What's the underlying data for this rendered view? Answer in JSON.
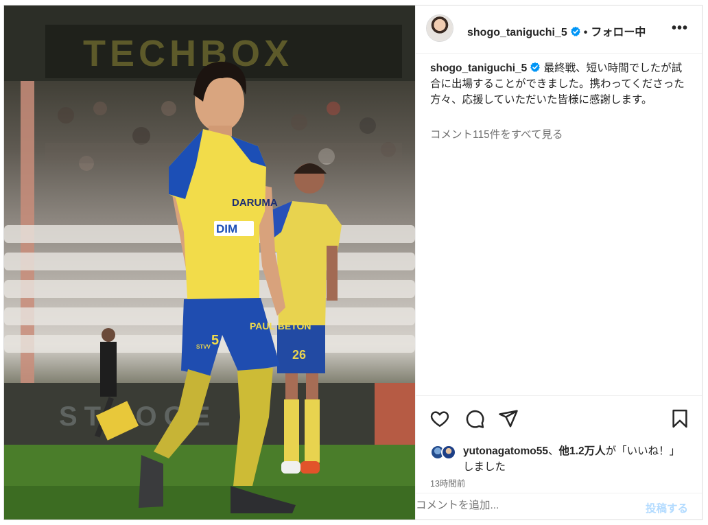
{
  "post": {
    "username": "shogo_taniguchi_5",
    "separator": "•",
    "follow_label": "フォロー中",
    "more_label": "•••",
    "caption_user": "shogo_taniguchi_5",
    "caption_text": "最終戦、短い時間でしたが試合に出場することができました。携わってくださった方々、応援していただいた皆様に感謝します。",
    "view_comments": "コメント115件をすべて見る",
    "likes": {
      "liker": "yutonagatomo55",
      "joiner": "、",
      "others": "他1.2万人",
      "suffix": "が「いいね！」しました"
    },
    "timestamp": "13時間前",
    "comment_placeholder": "コメントを追加...",
    "post_button": "投稿する"
  },
  "photo": {
    "stadium_sign": "TECHBOX",
    "board_text": "STOOGE",
    "jersey_sponsor": "DIM",
    "jersey_top": "DARUMA",
    "shorts_text": "PAUL BETON",
    "number": "5",
    "number2": "26",
    "club_short": "STVV"
  },
  "colors": {
    "verified_blue": "#0095f6",
    "post_button": "#b3dbff",
    "jersey_yellow": "#f2dc4a",
    "jersey_blue": "#1c4fb6"
  },
  "icons": {
    "like": "heart-icon",
    "comment": "comment-icon",
    "share": "send-icon",
    "save": "bookmark-icon"
  }
}
